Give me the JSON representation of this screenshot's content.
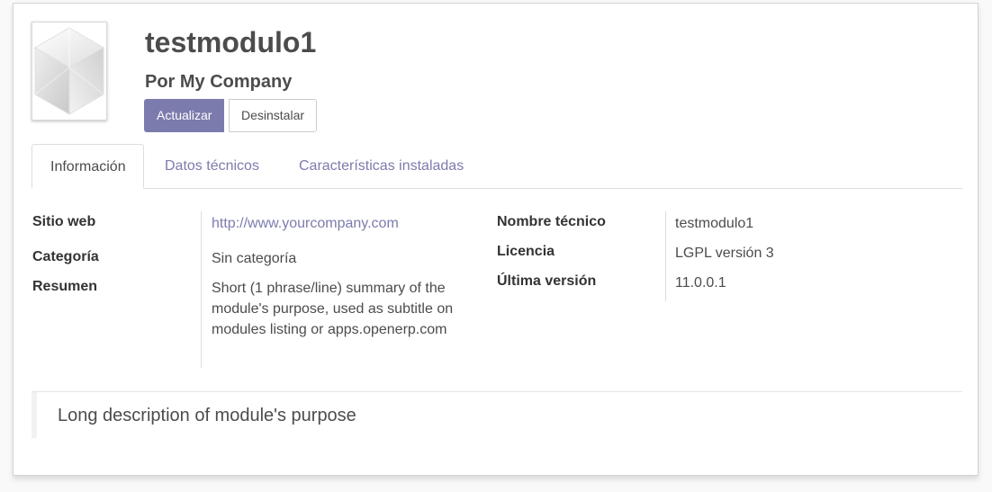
{
  "module": {
    "name": "testmodulo1",
    "author": "Por My Company"
  },
  "buttons": {
    "upgrade": "Actualizar",
    "uninstall": "Desinstalar"
  },
  "tabs": [
    {
      "label": "Información"
    },
    {
      "label": "Datos técnicos"
    },
    {
      "label": "Características instaladas"
    }
  ],
  "info": {
    "left": [
      {
        "label": "Sitio web",
        "value": "http://www.yourcompany.com"
      },
      {
        "label": "Categoría",
        "value": "Sin categoría"
      },
      {
        "label": "Resumen",
        "value": "Short (1 phrase/line) summary of the module's purpose, used as subtitle on modules listing or apps.openerp.com"
      }
    ],
    "right": [
      {
        "label": "Nombre técnico",
        "value": "testmodulo1"
      },
      {
        "label": "Licencia",
        "value": "LGPL versión 3"
      },
      {
        "label": "Última versión",
        "value": "11.0.0.1"
      }
    ]
  },
  "description": "Long description of module's purpose",
  "colors": {
    "primary": "#7c7bad",
    "text": "#4c4c4c"
  },
  "icons": {
    "module_image": "module-cube-icon"
  }
}
